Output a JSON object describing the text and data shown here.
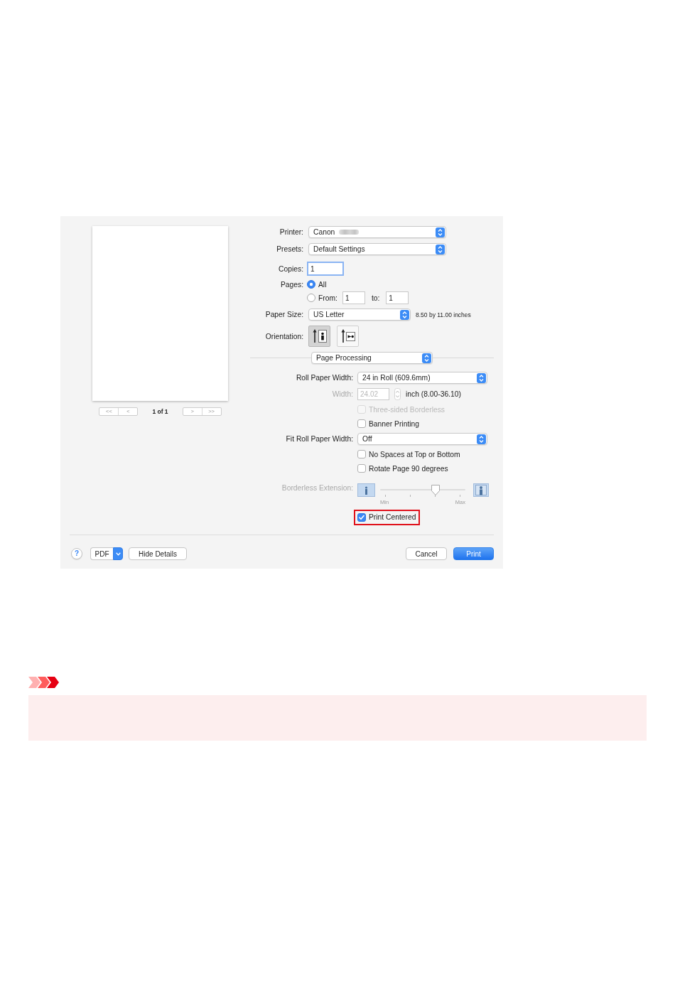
{
  "print_dialog": {
    "preview": {
      "first_page": "<<",
      "previous_page": "<",
      "page_indicator": "1 of 1",
      "next_page": ">",
      "last_page": ">>"
    },
    "printer": {
      "label": "Printer:",
      "value": "Canon",
      "name_blurred": true
    },
    "presets": {
      "label": "Presets:",
      "value": "Default Settings"
    },
    "copies": {
      "label": "Copies:",
      "value": "1",
      "focused": true
    },
    "pages": {
      "label": "Pages:",
      "options": [
        {
          "kind": "all",
          "label": "All",
          "selected": true
        },
        {
          "kind": "range",
          "label": "From:",
          "from": "1",
          "to_label": "to:",
          "to": "1",
          "selected": false
        }
      ]
    },
    "paper_size": {
      "label": "Paper Size:",
      "value": "US Letter",
      "dimensions": "8.50 by 11.00 inches"
    },
    "orientation": {
      "label": "Orientation:",
      "options": [
        {
          "kind": "portrait",
          "selected": true
        },
        {
          "kind": "landscape",
          "selected": false
        }
      ]
    },
    "section_menu": {
      "value": "Page Processing"
    },
    "page_processing": [
      {
        "kind": "popup",
        "label": "Roll Paper Width:",
        "value": "24 in Roll (609.6mm)"
      },
      {
        "kind": "number",
        "label": "Width:",
        "value": "24.02",
        "unit": "inch (8.00-36.10)",
        "disabled": true
      },
      {
        "kind": "checkbox",
        "label": "Three-sided Borderless",
        "checked": false,
        "disabled": true,
        "highlighted": false
      },
      {
        "kind": "checkbox",
        "label": "Banner Printing",
        "checked": false,
        "disabled": false,
        "highlighted": false
      },
      {
        "kind": "popup",
        "label": "Fit Roll Paper Width:",
        "value": "Off"
      },
      {
        "kind": "checkbox",
        "label": "No Spaces at Top or Bottom",
        "checked": false,
        "disabled": false,
        "highlighted": false
      },
      {
        "kind": "checkbox",
        "label": "Rotate Page 90 degrees",
        "checked": false,
        "disabled": false,
        "highlighted": false
      },
      {
        "kind": "slider",
        "label": "Borderless Extension:",
        "level": 0.65,
        "min_label": "Min",
        "max_label": "Max",
        "disabled": true
      },
      {
        "kind": "checkbox",
        "label": "Print Centered",
        "checked": true,
        "disabled": false,
        "highlighted": true
      }
    ],
    "footer": {
      "help": "?",
      "pdf": "PDF",
      "hide_details": "Hide Details",
      "cancel": "Cancel",
      "print": "Print"
    }
  }
}
